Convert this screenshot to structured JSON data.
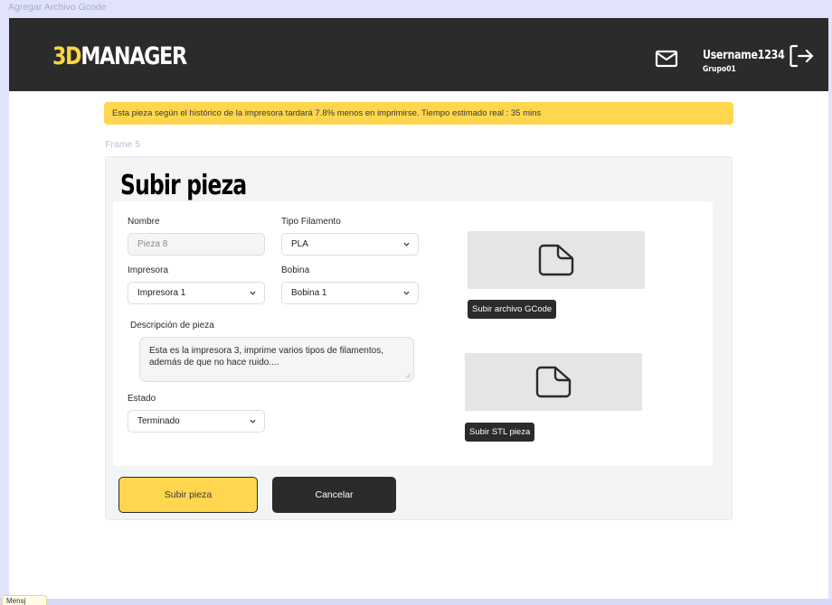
{
  "canvas": {
    "top_label": "Agregar Archivo Gcode",
    "frame_label": "Frame 5",
    "bottom_tag": "Mensj"
  },
  "header": {
    "logo_accent": "3D",
    "logo_rest": "MANAGER",
    "mail_icon": "mail-icon",
    "username": "Username1234",
    "group": "Grupo01",
    "logout_icon": "logout-icon"
  },
  "banner": {
    "text": "Esta pieza según el histórico de la impresora tardará 7.8% menos en imprimirse. Tiempo estimado real : 35 mins"
  },
  "form": {
    "title": "Subir pieza",
    "nombre": {
      "label": "Nombre",
      "placeholder": "Pieza 8"
    },
    "tipo_filamento": {
      "label": "Tipo Filamento",
      "value": "PLA"
    },
    "impresora": {
      "label": "Impresora",
      "value": "Impresora 1"
    },
    "bobina": {
      "label": "Bobina",
      "value": "Bobina 1"
    },
    "descripcion": {
      "label": "Descripción de pieza",
      "value": "Esta es la impresora 3, imprime varios tipos de filamentos, además de que no hace ruido...."
    },
    "estado": {
      "label": "Estado",
      "value": "Terminado"
    },
    "upload_gcode_label": "Subir archivo GCode",
    "upload_stl_label": "Subir STL pieza",
    "submit_label": "Subir pieza",
    "cancel_label": "Cancelar"
  },
  "colors": {
    "accent": "#ffd64d",
    "header_bg": "#2b2b2b",
    "canvas_bg": "#e0e3fa"
  }
}
